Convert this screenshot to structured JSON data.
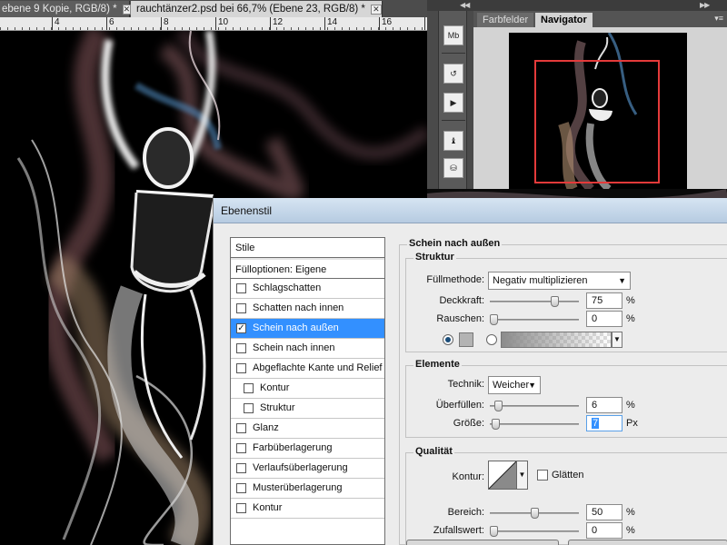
{
  "tabs": [
    {
      "label": "ebene 9 Kopie, RGB/8) *",
      "close": "✕",
      "active": false
    },
    {
      "label": "rauchtänzer2.psd bei 66,7% (Ebene 23, RGB/8) *",
      "close": "✕",
      "active": true
    }
  ],
  "ruler": {
    "labels": [
      "4",
      "6",
      "8",
      "10",
      "12",
      "14",
      "16",
      "18"
    ]
  },
  "dock": {
    "collapse_glyph": "◀◀",
    "expand_glyph": "▶▶",
    "tool_buttons": [
      {
        "icon": "mini-bridge-icon",
        "glyph": "Mb"
      },
      {
        "icon": "history-icon",
        "glyph": "↺"
      },
      {
        "icon": "actions-play-icon",
        "glyph": "▶"
      },
      {
        "icon": "brush-presets-icon",
        "glyph": "♝"
      },
      {
        "icon": "clone-source-icon",
        "glyph": "⛁"
      }
    ],
    "panel_tabs": [
      {
        "label": "Farbfelder",
        "active": false
      },
      {
        "label": "Navigator",
        "active": true
      }
    ],
    "panel_menu": "▾≡"
  },
  "dialog": {
    "title": "Ebenenstil",
    "list_header": "Stile",
    "blend_options": "Fülloptionen: Eigene",
    "items": [
      {
        "label": "Schlagschatten",
        "checked": false,
        "indent": false,
        "selected": false
      },
      {
        "label": "Schatten nach innen",
        "checked": false,
        "indent": false,
        "selected": false
      },
      {
        "label": "Schein nach außen",
        "checked": true,
        "indent": false,
        "selected": true
      },
      {
        "label": "Schein nach innen",
        "checked": false,
        "indent": false,
        "selected": false
      },
      {
        "label": "Abgeflachte Kante und Relief",
        "checked": false,
        "indent": false,
        "selected": false
      },
      {
        "label": "Kontur",
        "checked": false,
        "indent": true,
        "selected": false
      },
      {
        "label": "Struktur",
        "checked": false,
        "indent": true,
        "selected": false
      },
      {
        "label": "Glanz",
        "checked": false,
        "indent": false,
        "selected": false
      },
      {
        "label": "Farbüberlagerung",
        "checked": false,
        "indent": false,
        "selected": false
      },
      {
        "label": "Verlaufsüberlagerung",
        "checked": false,
        "indent": false,
        "selected": false
      },
      {
        "label": "Musterüberlagerung",
        "checked": false,
        "indent": false,
        "selected": false
      },
      {
        "label": "Kontur",
        "checked": false,
        "indent": false,
        "selected": false
      }
    ],
    "settings": {
      "section_title": "Schein nach außen",
      "struktur": {
        "title": "Struktur",
        "blend_mode_label": "Füllmethode:",
        "blend_mode_value": "Negativ multiplizieren",
        "opacity_label": "Deckkraft:",
        "opacity_value": "75",
        "opacity_fraction": 0.75,
        "noise_label": "Rauschen:",
        "noise_value": "0",
        "noise_fraction": 0.0,
        "percent": "%",
        "color_mode": "solid",
        "swatch_color": "#b3b3b3"
      },
      "elemente": {
        "title": "Elemente",
        "technique_label": "Technik:",
        "technique_value": "Weicher",
        "spread_label": "Überfüllen:",
        "spread_value": "6",
        "spread_fraction": 0.06,
        "size_label": "Größe:",
        "size_value": "7",
        "size_fraction": 0.028,
        "percent": "%",
        "px": "Px"
      },
      "qualitaet": {
        "title": "Qualität",
        "contour_label": "Kontur:",
        "antialias_label": "Glätten",
        "antialias_checked": false,
        "range_label": "Bereich:",
        "range_value": "50",
        "range_fraction": 0.5,
        "jitter_label": "Zufallswert:",
        "jitter_value": "0",
        "jitter_fraction": 0.0,
        "percent": "%"
      }
    }
  },
  "colors": {
    "selection": "#3390ff",
    "navigator_frame": "#e43a3a",
    "titlebar_top": "#d6e4f2",
    "titlebar_bottom": "#b6cbe1"
  }
}
